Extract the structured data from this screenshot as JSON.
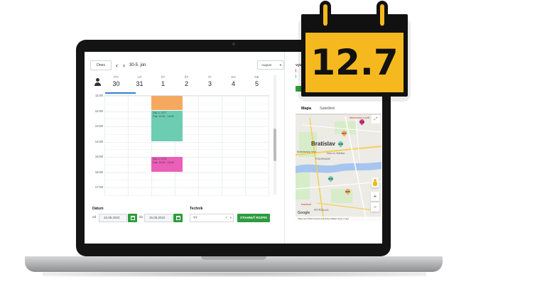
{
  "calendar_toolbar": {
    "today_label": "Dnes",
    "prev_icon": "chevron-left-icon",
    "next_icon": "chevron-right-icon",
    "date_range": "30-5. jún",
    "month_select": "August"
  },
  "days": [
    {
      "abbr": "PO",
      "num": "30"
    },
    {
      "abbr": "UT",
      "num": "31"
    },
    {
      "abbr": "ST",
      "num": "1"
    },
    {
      "abbr": "ŠT",
      "num": "2"
    },
    {
      "abbr": "PI",
      "num": "3"
    },
    {
      "abbr": "SO",
      "num": "4"
    },
    {
      "abbr": "NE",
      "num": "5"
    }
  ],
  "hours": [
    "11:00",
    "12:00",
    "13:00",
    "14:00",
    "15:00",
    "16:00",
    "17:00"
  ],
  "events": [
    {
      "title": "",
      "time": ""
    },
    {
      "title": "Obj. č. 1377",
      "time": "Čas: 12:00 - 14:00"
    },
    {
      "title": "Obj. č. 1378",
      "time": "Čas: 15:00 - 16:00"
    }
  ],
  "form": {
    "date_label": "Dátum",
    "from_label": "od",
    "from_value": "15.08.2022",
    "to_label": "do",
    "to_value": "15.08.2022",
    "tech_label": "Technik",
    "tech_value": "TT",
    "download_label": "STIAHNUŤ ROZPIS"
  },
  "side_panel": {
    "label": "Vybe"
  },
  "map": {
    "tab_map": "Mapa",
    "tab_satellite": "Satelitné",
    "city": "Bratislav",
    "places": [
      "Nemocnica s polik",
      "Dóm sv. Martina",
      "Bratislavský hrad",
      "PODHRADIE",
      "PETRŽALKA",
      "Kaufland"
    ],
    "markers": [
      "1376",
      "1377",
      "1378",
      "1379",
      "1375"
    ],
    "footer": "Údaje máp ©2022   Zmluvné podmienky   Nahlásiť chybu v mape",
    "google": "Google",
    "zoom_in": "+",
    "zoom_out": "−"
  },
  "badge": {
    "value": "12.7"
  },
  "colors": {
    "accent_green": "#2e9c3f",
    "event_orange": "#f5a960",
    "event_teal": "#6ccdb3",
    "event_pink": "#ea5fb8",
    "badge_yellow": "#f5b91f"
  }
}
